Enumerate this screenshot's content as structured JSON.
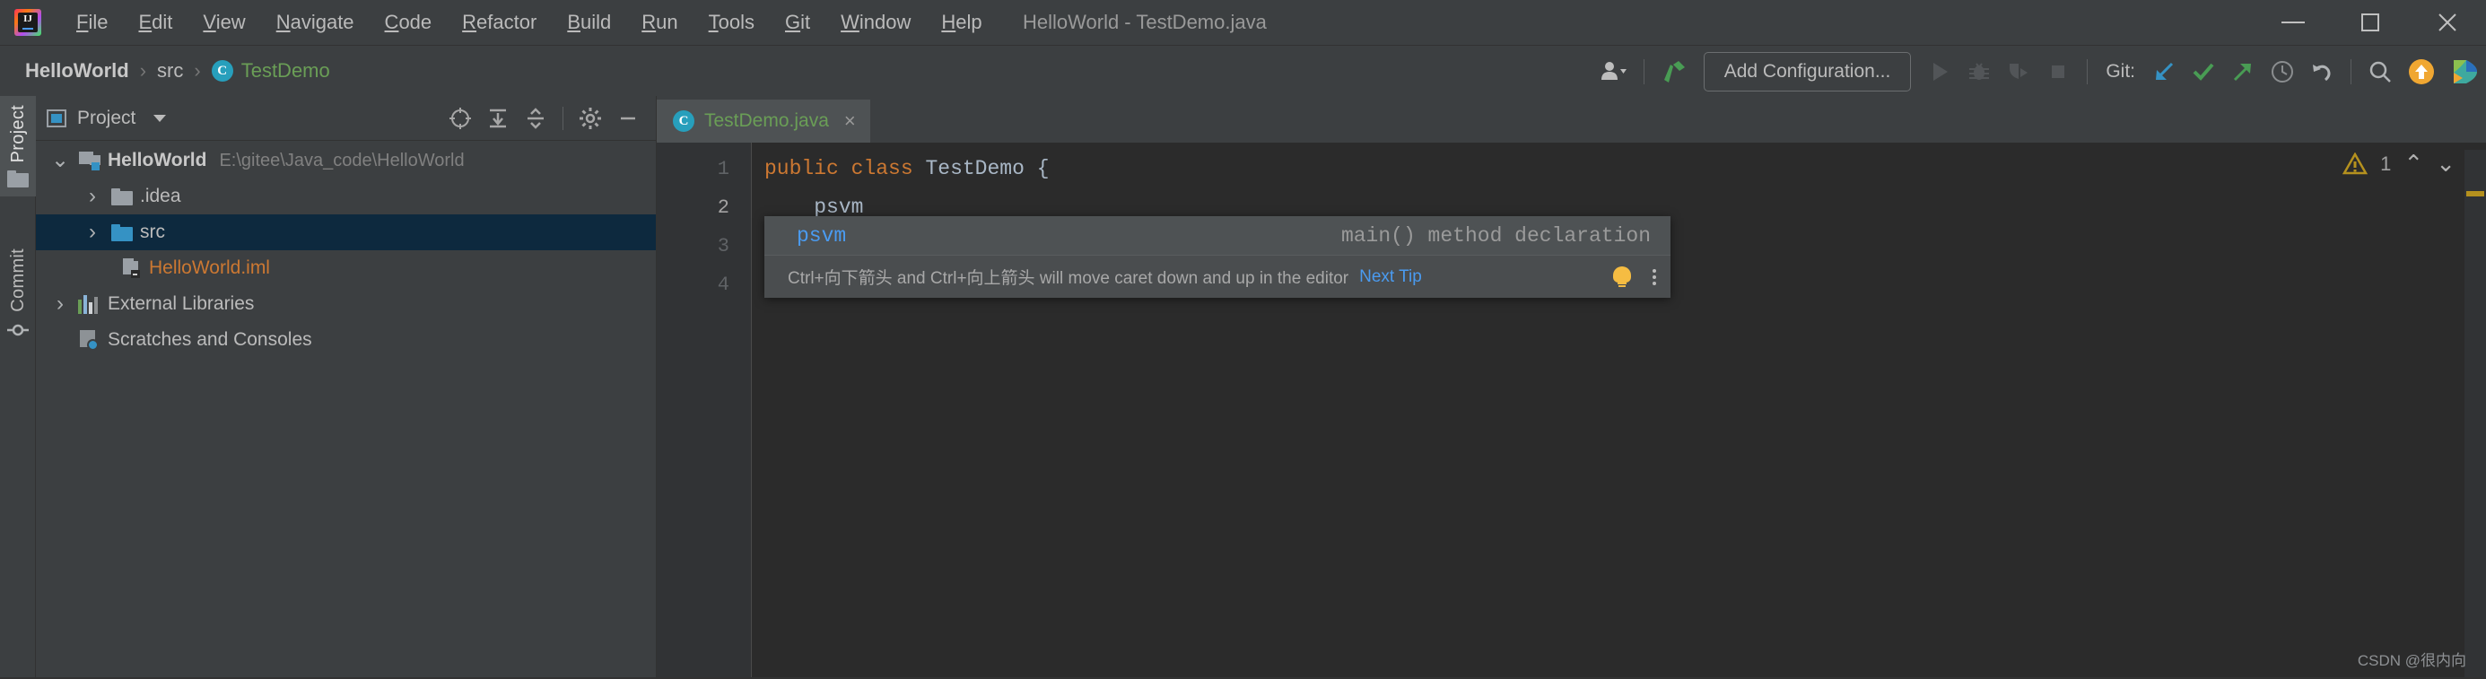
{
  "window": {
    "title": "HelloWorld - TestDemo.java",
    "logo_text": "IJ",
    "controls": {
      "minimize": "Minimize",
      "maximize": "Maximize",
      "close": "Close"
    }
  },
  "menubar": {
    "items": [
      {
        "label": "File",
        "mnemonic": "F",
        "rest": "ile"
      },
      {
        "label": "Edit",
        "mnemonic": "E",
        "rest": "dit"
      },
      {
        "label": "View",
        "mnemonic": "V",
        "rest": "iew"
      },
      {
        "label": "Navigate",
        "mnemonic": "N",
        "rest": "avigate"
      },
      {
        "label": "Code",
        "mnemonic": "C",
        "rest": "ode"
      },
      {
        "label": "Refactor",
        "mnemonic": "R",
        "rest": "efactor"
      },
      {
        "label": "Build",
        "mnemonic": "B",
        "rest": "uild"
      },
      {
        "label": "Run",
        "mnemonic": "R",
        "rest": "un"
      },
      {
        "label": "Tools",
        "mnemonic": "T",
        "rest": "ools"
      },
      {
        "label": "Git",
        "mnemonic": "G",
        "rest": "it"
      },
      {
        "label": "Window",
        "mnemonic": "W",
        "rest": "indow"
      },
      {
        "label": "Help",
        "mnemonic": "H",
        "rest": "elp"
      }
    ]
  },
  "navbar": {
    "breadcrumbs": [
      {
        "label": "HelloWorld",
        "style": "bold"
      },
      {
        "label": "src",
        "style": "plain"
      },
      {
        "label": "TestDemo",
        "style": "green",
        "icon": "class-icon",
        "icon_text": "C"
      }
    ],
    "separator": "›",
    "add_configuration": "Add Configuration...",
    "git_label": "Git:"
  },
  "stripe": {
    "tabs": [
      {
        "label": "Project",
        "icon": "folder-icon",
        "active": true
      },
      {
        "label": "Commit",
        "icon": "commit-icon",
        "active": false
      }
    ]
  },
  "project_panel": {
    "title": "Project",
    "tree": [
      {
        "label": "HelloWorld",
        "path": "E:\\gitee\\Java_code\\HelloWorld",
        "icon": "module-icon",
        "chevron": "⌄",
        "expanded": true,
        "indent": 0,
        "selected": false,
        "style": "bold"
      },
      {
        "label": ".idea",
        "path": "",
        "icon": "folder-icon",
        "chevron": "›",
        "expanded": false,
        "indent": 1,
        "selected": false,
        "style": "plain"
      },
      {
        "label": "src",
        "path": "",
        "icon": "source-folder-icon",
        "chevron": "›",
        "expanded": false,
        "indent": 1,
        "selected": true,
        "style": "plain"
      },
      {
        "label": "HelloWorld.iml",
        "path": "",
        "icon": "iml-file-icon",
        "chevron": "",
        "expanded": false,
        "indent": 2,
        "selected": false,
        "style": "iml"
      },
      {
        "label": "External Libraries",
        "path": "",
        "icon": "library-icon",
        "chevron": "›",
        "expanded": false,
        "indent": 0,
        "selected": false,
        "style": "plain"
      },
      {
        "label": "Scratches and Consoles",
        "path": "",
        "icon": "scratches-icon",
        "chevron": "",
        "expanded": false,
        "indent": 0,
        "selected": false,
        "style": "plain"
      }
    ]
  },
  "editor": {
    "tab": {
      "label": "TestDemo.java",
      "icon": "class-icon",
      "icon_text": "C",
      "close": "×"
    },
    "line_numbers": [
      "1",
      "2",
      "3",
      "4"
    ],
    "current_line": 2,
    "lines": [
      {
        "tokens": [
          {
            "t": "public",
            "c": "kw"
          },
          {
            "t": " ",
            "c": "id"
          },
          {
            "t": "class",
            "c": "kw"
          },
          {
            "t": " ",
            "c": "id"
          },
          {
            "t": "TestDemo",
            "c": "id"
          },
          {
            "t": " ",
            "c": "id"
          },
          {
            "t": "{",
            "c": "brc"
          }
        ]
      },
      {
        "tokens": [
          {
            "t": "    psvm",
            "c": "id"
          }
        ]
      },
      {
        "tokens": [
          {
            "t": "}",
            "c": "brc"
          }
        ]
      },
      {
        "tokens": [
          {
            "t": "",
            "c": "id"
          }
        ]
      }
    ],
    "autocomplete": {
      "item_name": "psvm",
      "item_description": "main() method declaration",
      "tip_text": "Ctrl+向下箭头 and Ctrl+向上箭头 will move caret down and up in the editor",
      "tip_link": "Next Tip"
    },
    "warning": {
      "count": "1",
      "up": "⌃",
      "down": "⌄"
    }
  },
  "watermark": "CSDN @很内向",
  "colors": {
    "keyword": "#cc7832",
    "identifier": "#a9b7c6",
    "class_green": "#6a9e56",
    "accent_blue": "#4a88c7",
    "selection": "#0d293e",
    "iml_orange": "#cc7832",
    "warning": "#b5911e",
    "popup_blue": "#4a9bf0"
  }
}
